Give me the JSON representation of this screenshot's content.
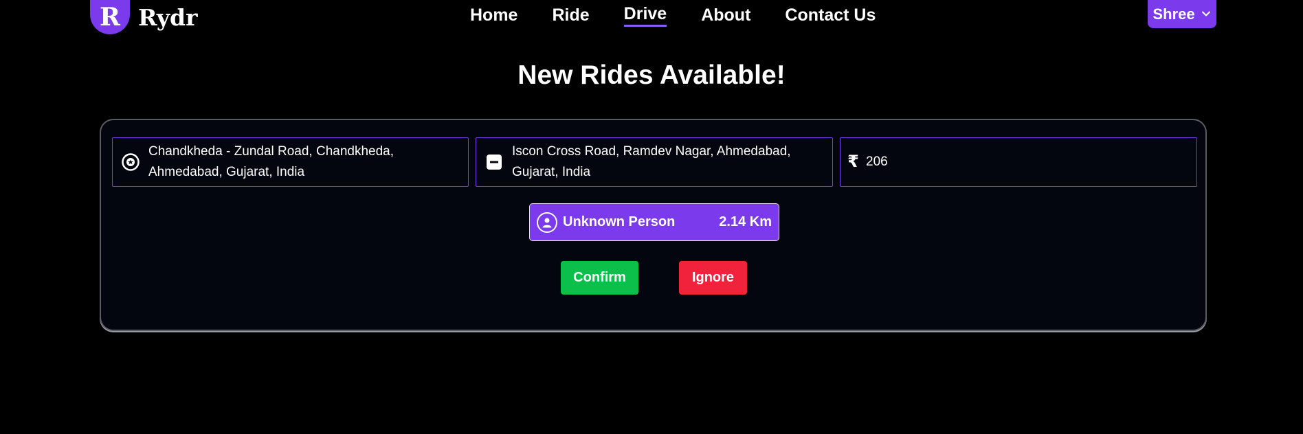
{
  "brand": {
    "logo_letter": "R",
    "name": "Rydr",
    "accent": "#7c3aed"
  },
  "nav": {
    "items": [
      {
        "label": "Home"
      },
      {
        "label": "Ride"
      },
      {
        "label": "Drive",
        "active": true
      },
      {
        "label": "About"
      },
      {
        "label": "Contact Us"
      }
    ]
  },
  "user_menu": {
    "label": "Shree",
    "icon": "chevron-down-icon"
  },
  "page": {
    "title": "New Rides Available!"
  },
  "ride": {
    "pickup": {
      "icon": "pickup-marker-icon",
      "value": "Chandkheda - Zundal Road, Chandkheda, Ahmedabad, Gujarat, India"
    },
    "dropoff": {
      "icon": "dropoff-marker-icon",
      "value": "Iscon Cross Road, Ramdev Nagar, Ahmedabad, Gujarat, India"
    },
    "fare": {
      "currency_symbol": "₹",
      "value": "206"
    },
    "rider": {
      "icon": "user-icon",
      "name": "Unknown Person",
      "distance": "2.14 Km"
    },
    "actions": {
      "confirm_label": "Confirm",
      "confirm_color": "#0bbf4a",
      "ignore_label": "Ignore",
      "ignore_color": "#f1233c"
    }
  }
}
